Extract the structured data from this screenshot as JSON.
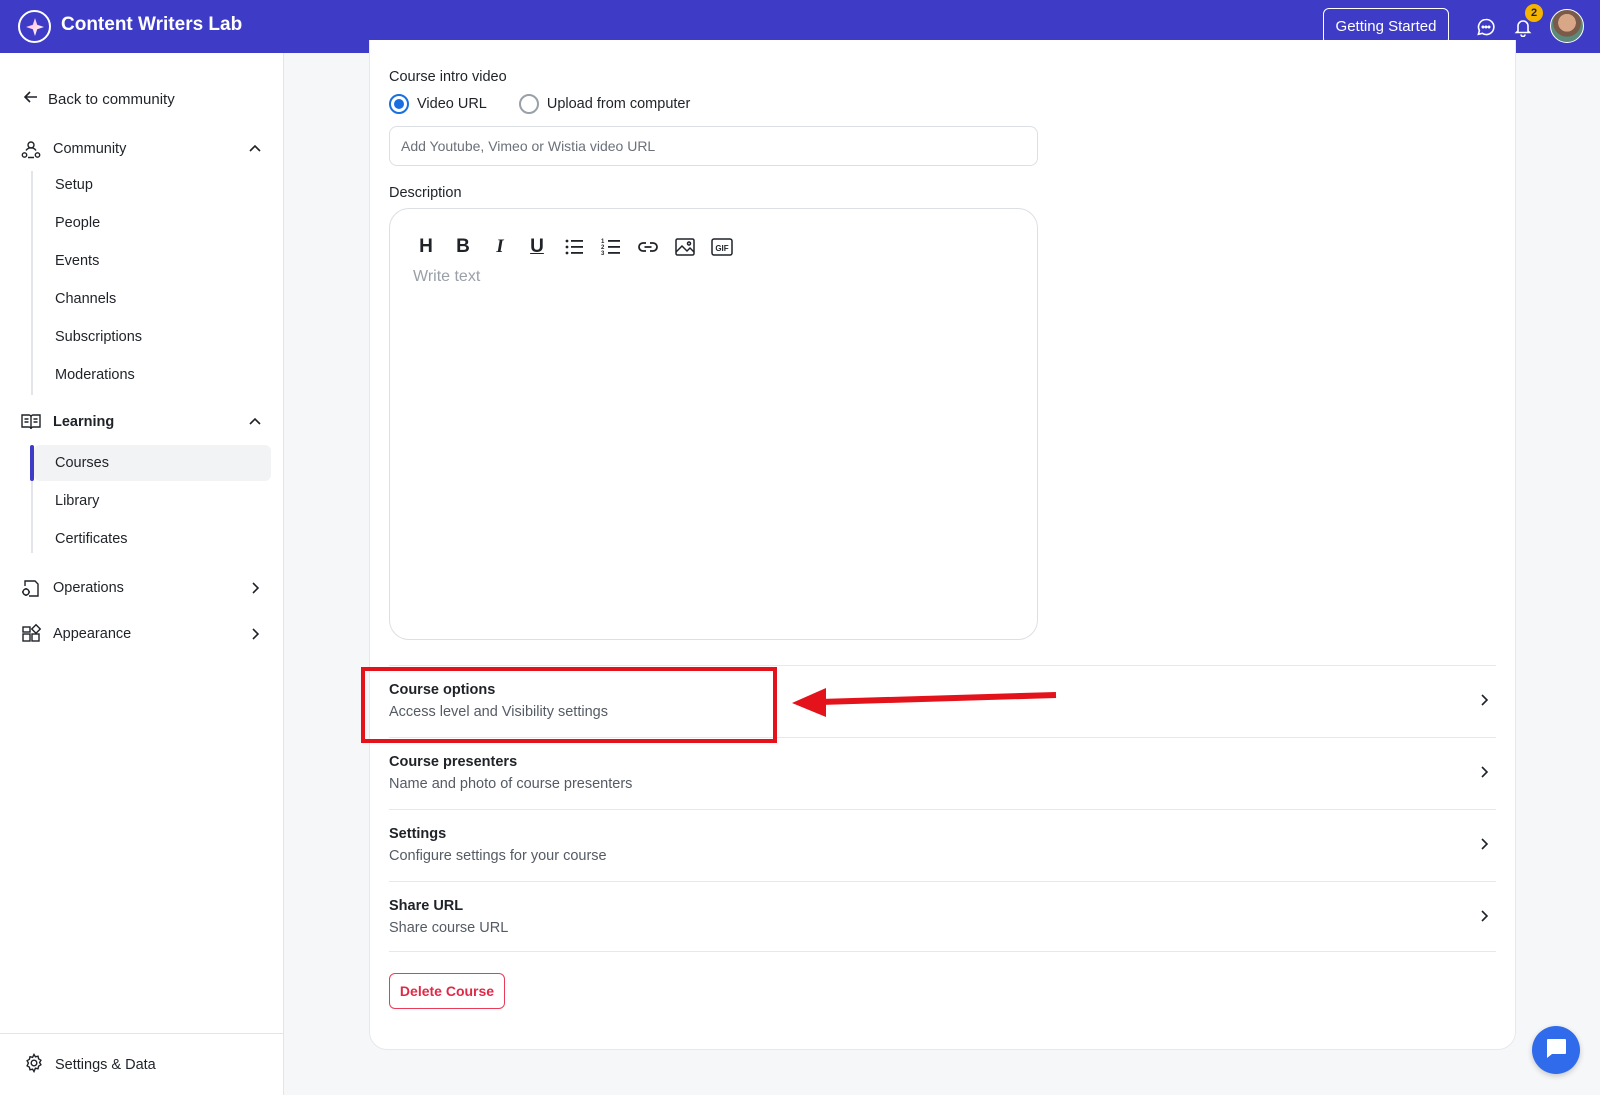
{
  "header": {
    "app_title": "Content Writers Lab",
    "getting_started_label": "Getting Started",
    "notification_count": "2",
    "brand_color": "#3e3bc7"
  },
  "sidebar": {
    "back_label": "Back to community",
    "groups": [
      {
        "label": "Community",
        "icon": "community-icon",
        "expanded": true,
        "items": [
          "Setup",
          "People",
          "Events",
          "Channels",
          "Subscriptions",
          "Moderations"
        ]
      },
      {
        "label": "Learning",
        "icon": "book-icon",
        "expanded": true,
        "items": [
          "Courses",
          "Library",
          "Certificates"
        ],
        "active_item": "Courses"
      },
      {
        "label": "Operations",
        "icon": "operations-icon",
        "expanded": false,
        "items": []
      },
      {
        "label": "Appearance",
        "icon": "appearance-icon",
        "expanded": false,
        "items": []
      }
    ],
    "footer_label": "Settings & Data"
  },
  "main": {
    "intro_video_label": "Course intro video",
    "radio_options": [
      {
        "label": "Video URL",
        "selected": true
      },
      {
        "label": "Upload from computer",
        "selected": false
      }
    ],
    "url_placeholder": "Add Youtube, Vimeo or Wistia video URL",
    "description_label": "Description",
    "editor_placeholder": "Write text",
    "toolbar_icons": [
      "heading-icon",
      "bold-icon",
      "italic-icon",
      "underline-icon",
      "bullet-list-icon",
      "numbered-list-icon",
      "link-icon",
      "image-icon",
      "gif-icon"
    ],
    "toolbar_labels": {
      "heading": "H",
      "bold": "B",
      "italic": "I",
      "underline": "U",
      "gif": "GIF"
    },
    "options": [
      {
        "title": "Course options",
        "subtitle": "Access level and Visibility settings"
      },
      {
        "title": "Course presenters",
        "subtitle": "Name and photo of course presenters"
      },
      {
        "title": "Settings",
        "subtitle": "Configure settings for your course"
      },
      {
        "title": "Share URL",
        "subtitle": "Share course URL"
      }
    ],
    "delete_label": "Delete Course"
  },
  "annotation": {
    "highlight_color": "#e3121b",
    "highlighted_option": "Course options"
  }
}
